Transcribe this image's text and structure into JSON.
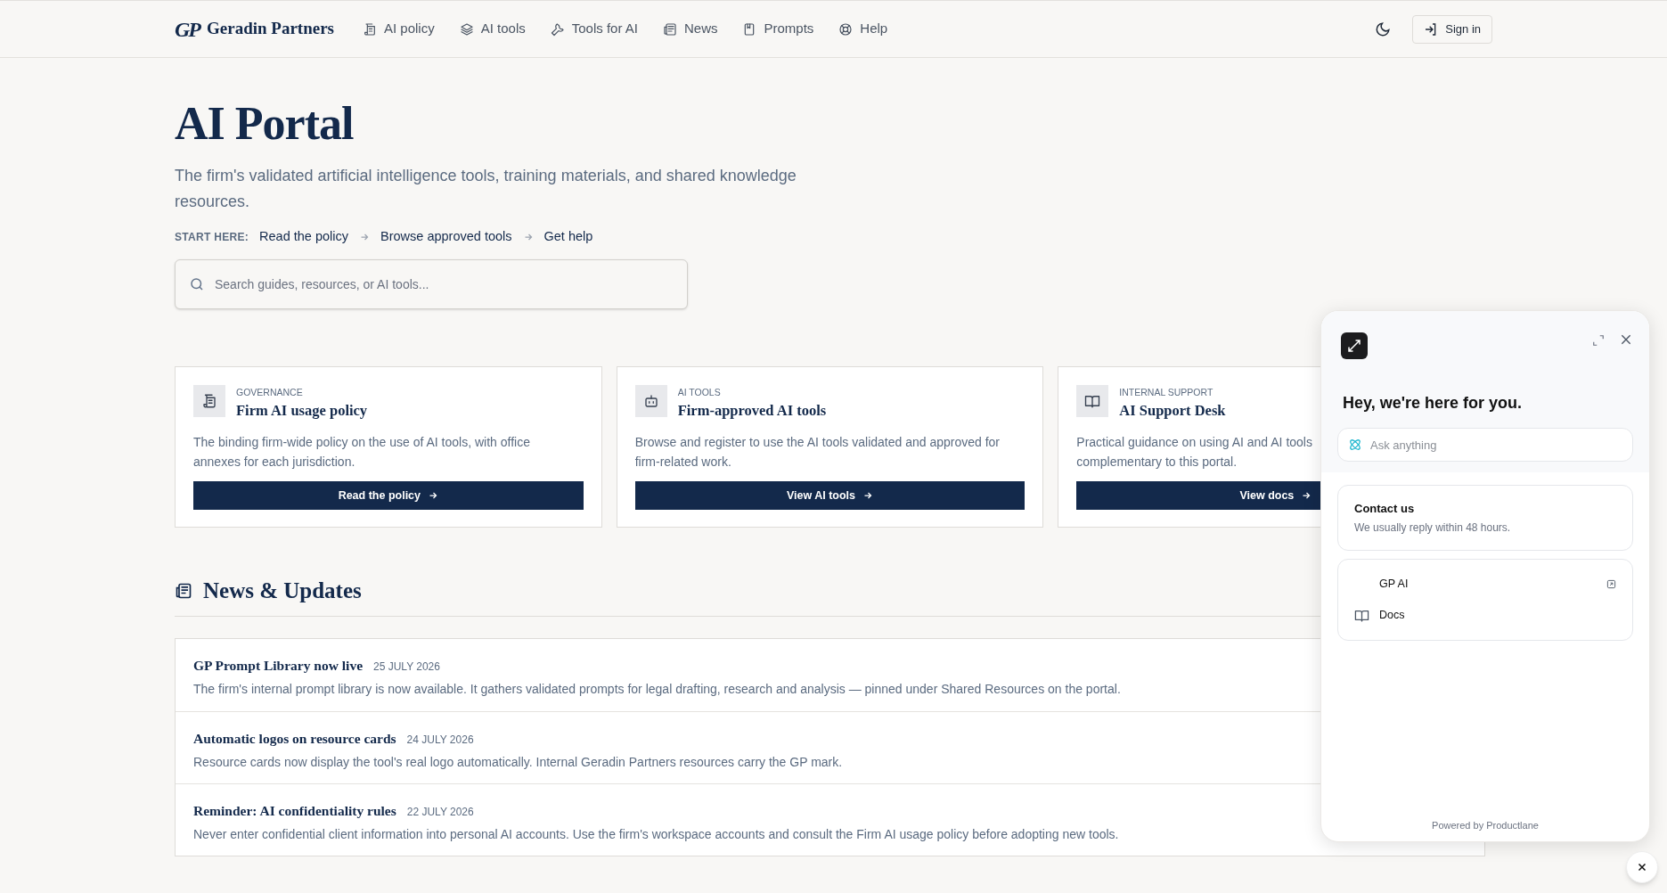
{
  "header": {
    "brand": "Geradin Partners",
    "logo": "GP",
    "nav": [
      {
        "label": "AI policy"
      },
      {
        "label": "AI tools"
      },
      {
        "label": "Tools for AI"
      },
      {
        "label": "News"
      },
      {
        "label": "Prompts"
      },
      {
        "label": "Help"
      }
    ],
    "sign_in": "Sign in"
  },
  "hero": {
    "title": "AI Portal",
    "subtitle": "The firm's validated artificial intelligence tools, training materials, and shared knowledge resources.",
    "start_label": "START HERE:",
    "steps": [
      "Read the policy",
      "Browse approved tools",
      "Get help"
    ],
    "search": {
      "placeholder": "Search guides, resources, or AI tools..."
    }
  },
  "cards": [
    {
      "category": "GOVERNANCE",
      "title": "Firm AI usage policy",
      "description_lines": [
        "The binding firm-wide policy on the use of AI tools, with office",
        "annexes for each jurisdiction."
      ],
      "button": "Read the policy"
    },
    {
      "category": "AI TOOLS",
      "title": "Firm-approved AI tools",
      "description_lines": [
        "Browse and register to use the AI tools validated and approved for",
        "firm-related work."
      ],
      "button": "View AI tools"
    },
    {
      "category": "INTERNAL SUPPORT",
      "title": "AI Support Desk",
      "description_lines": [
        "Practical guidance on using AI and AI tools",
        "complementary to this portal."
      ],
      "button": "View docs"
    }
  ],
  "news": {
    "title": "News & Updates",
    "items": [
      {
        "title": "GP Prompt Library now live",
        "date": "25 JULY 2026",
        "body": "The firm's internal prompt library is now available. It gathers validated prompts for legal drafting, research and analysis — pinned under Shared Resources on the portal."
      },
      {
        "title": "Automatic logos on resource cards",
        "date": "24 JULY 2026",
        "body": "Resource cards now display the tool's real logo automatically. Internal Geradin Partners resources carry the GP mark."
      },
      {
        "title": "Reminder: AI confidentiality rules",
        "date": "22 JULY 2026",
        "body": "Never enter confidential client information into personal AI accounts. Use the firm's workspace accounts and consult the Firm AI usage policy before adopting new tools."
      }
    ]
  },
  "chat_widget": {
    "greeting": "Hey, we're here for you.",
    "ask_placeholder": "Ask anything",
    "contact": {
      "title": "Contact us",
      "subtitle": "We usually reply within 48 hours."
    },
    "links": [
      {
        "label": "GP AI"
      },
      {
        "label": "Docs"
      }
    ],
    "footer": "Powered by Productlane"
  }
}
